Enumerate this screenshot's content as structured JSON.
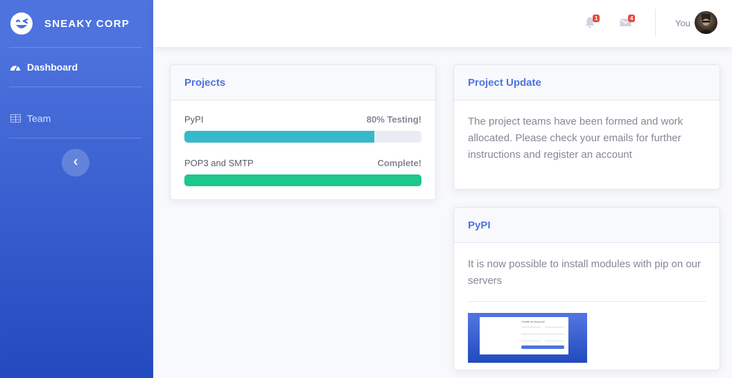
{
  "brand": {
    "name": "SNEAKY CORP"
  },
  "sidebar": {
    "items": [
      {
        "label": "Dashboard",
        "icon": "tachometer-icon"
      },
      {
        "label": "Team",
        "icon": "table-icon"
      }
    ],
    "toggle_icon": "chevron-left-icon"
  },
  "topbar": {
    "alerts": {
      "icon": "bell-icon",
      "count": "1"
    },
    "messages": {
      "icon": "envelope-icon",
      "count": "4"
    },
    "user": {
      "name": "You"
    }
  },
  "projects": {
    "title": "Projects",
    "items": [
      {
        "name": "PyPI",
        "status": "80% Testing!",
        "progress": 0.8,
        "color": "#36b9cc"
      },
      {
        "name": "POP3 and SMTP",
        "status": "Complete!",
        "progress": 1.0,
        "color": "#1cc88a"
      }
    ]
  },
  "update": {
    "title": "Project Update",
    "text": "The project teams have been formed and work allocated. Please check your emails for further instructions and register an account"
  },
  "pypi": {
    "title": "PyPI",
    "text": "It is now possible to install modules with pip on our servers",
    "thumbnail": {
      "title": "Create an Account!"
    }
  },
  "colors": {
    "primary": "#4e73df",
    "info": "#36b9cc",
    "success": "#1cc88a",
    "danger": "#e74a3b"
  }
}
